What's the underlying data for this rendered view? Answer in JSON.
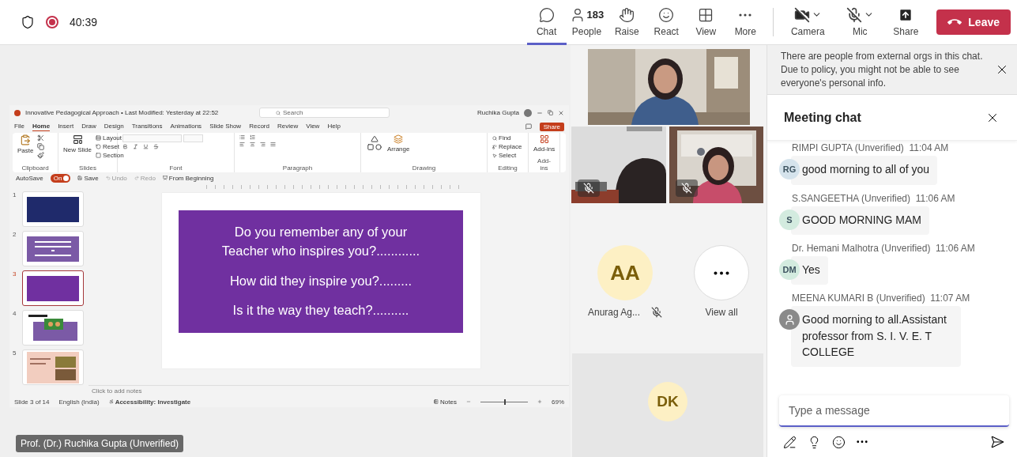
{
  "top_bar": {
    "recording": true,
    "timer": "40:39",
    "controls": [
      {
        "kind": "chat",
        "label": "Chat",
        "selected": true
      },
      {
        "kind": "people",
        "label": "People",
        "count": "183",
        "selected": false
      },
      {
        "kind": "raise",
        "label": "Raise",
        "selected": false
      },
      {
        "kind": "react",
        "label": "React",
        "selected": false
      },
      {
        "kind": "view",
        "label": "View",
        "selected": false
      },
      {
        "kind": "more",
        "label": "More",
        "selected": false
      }
    ],
    "devices": [
      {
        "kind": "camera",
        "label": "Camera",
        "on": false
      },
      {
        "kind": "mic",
        "label": "Mic",
        "on": false
      },
      {
        "kind": "share",
        "label": "Share"
      }
    ],
    "leave": "Leave"
  },
  "shared_screen": {
    "title": "Innovative Pedagogical Approach • Last Modified: Yesterday at 22:52",
    "search_placeholder": "Search",
    "user_name": "Ruchika Gupta",
    "menu_tabs": [
      {
        "label": "File",
        "selected": false
      },
      {
        "label": "Home",
        "selected": true
      },
      {
        "label": "Insert",
        "selected": false
      },
      {
        "label": "Draw",
        "selected": false
      },
      {
        "label": "Design",
        "selected": false
      },
      {
        "label": "Transitions",
        "selected": false
      },
      {
        "label": "Animations",
        "selected": false
      },
      {
        "label": "Slide Show",
        "selected": false
      },
      {
        "label": "Record",
        "selected": false
      },
      {
        "label": "Review",
        "selected": false
      },
      {
        "label": "View",
        "selected": false
      },
      {
        "label": "Help",
        "selected": false
      }
    ],
    "share": "Share",
    "ribbon_groups": [
      {
        "kind": "clipboard",
        "label": "Clipboard",
        "buttons": [
          "Paste"
        ]
      },
      {
        "kind": "slides",
        "label": "Slides",
        "buttons": [
          "New Slide",
          "Layout",
          "Reset",
          "Section"
        ]
      },
      {
        "kind": "font",
        "label": "Font"
      },
      {
        "kind": "paragraph",
        "label": "Paragraph"
      },
      {
        "kind": "drawing",
        "label": "Drawing",
        "buttons": [
          "Arrange"
        ]
      },
      {
        "kind": "editing",
        "label": "Editing",
        "buttons": [
          "Find",
          "Replace",
          "Select"
        ]
      },
      {
        "kind": "addins",
        "label": "Add-ins",
        "buttons": [
          "Add-ins"
        ]
      }
    ],
    "quick_access": {
      "autosave": "AutoSave",
      "autosave_on": true,
      "toggle_label": "On",
      "items": [
        "Save",
        "Undo",
        "Redo",
        "From Beginning"
      ]
    },
    "thumbnails": [
      {
        "number": "1",
        "kind": "title",
        "selected": false
      },
      {
        "number": "2",
        "kind": "quote",
        "selected": false
      },
      {
        "number": "3",
        "kind": "questions",
        "selected": true
      },
      {
        "number": "4",
        "kind": "teaching",
        "selected": false
      },
      {
        "number": "5",
        "kind": "collage",
        "selected": false
      }
    ],
    "slide_paragraphs": [
      "Do you remember any of your Teacher who inspires you?............",
      "How did they inspire you?.........",
      "Is it the way they teach?.........."
    ],
    "notes_placeholder": "Click to add notes",
    "status": {
      "slide": "Slide 3 of 14",
      "language": "English (India)",
      "accessibility": "Accessibility: Investigate",
      "notes": "Notes",
      "zoom_slider": {
        "level": 0.5
      },
      "zoom": "69%"
    }
  },
  "presenter_name": "Prof. (Dr.) Ruchika Gupta (Unverified)",
  "videos": [
    {
      "muted": false
    },
    {
      "muted": true
    },
    {
      "muted": true
    }
  ],
  "participants": [
    {
      "initials": "AA",
      "name": "Anurag Ag...",
      "muted": true
    }
  ],
  "view_all": "View all",
  "bottom_tile": {
    "initials": "DK"
  },
  "chat": {
    "notice": "There are people from external orgs in this chat. Due to policy, you might not be able to see everyone's personal info.",
    "title": "Meeting chat",
    "messages": [
      {
        "sender": "RIMPI GUPTA (Unverified)",
        "time": "11:04 AM",
        "kind": "initials",
        "initials": "RG",
        "color": "#d5e3ec",
        "text": "good morning to all of you"
      },
      {
        "sender": "S.SANGEETHA (Unverified)",
        "time": "11:06 AM",
        "kind": "initials",
        "initials": "S",
        "color": "#d3ebdf",
        "text": "GOOD MORNING MAM"
      },
      {
        "sender": "Dr. Hemani Malhotra (Unverified)",
        "time": "11:06 AM",
        "kind": "initials",
        "initials": "DM",
        "color": "#d3ebdf",
        "text": "Yes"
      },
      {
        "sender": "MEENA KUMARI B (Unverified)",
        "time": "11:07 AM",
        "kind": "person",
        "color": "#8a8a8a",
        "text": "Good morning to all.Assistant professor from S. I. V. E. T COLLEGE"
      }
    ],
    "composer_placeholder": "Type a message"
  }
}
